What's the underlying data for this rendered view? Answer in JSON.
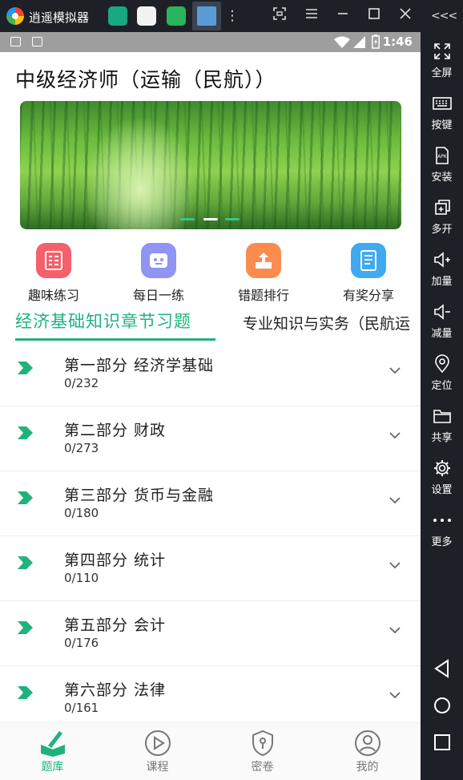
{
  "emulator": {
    "title": "逍遥模拟器",
    "side_buttons": [
      {
        "label": "全屏",
        "icon": "fullscreen-icon"
      },
      {
        "label": "按键",
        "icon": "keyboard-icon"
      },
      {
        "label": "安装",
        "icon": "apk-install-icon"
      },
      {
        "label": "多开",
        "icon": "multi-instance-icon"
      },
      {
        "label": "加量",
        "icon": "volume-up-icon"
      },
      {
        "label": "减量",
        "icon": "volume-down-icon"
      },
      {
        "label": "定位",
        "icon": "location-pin-icon"
      },
      {
        "label": "共享",
        "icon": "folder-icon"
      },
      {
        "label": "设置",
        "icon": "gear-icon"
      },
      {
        "label": "更多",
        "icon": "more-dots-icon"
      }
    ],
    "collapse_glyph": "<<<"
  },
  "status_bar": {
    "time": "1:46"
  },
  "app": {
    "title": "中级经济师（运输（民航））",
    "banner": {
      "slides": 3,
      "active_slide": 2
    },
    "quick_actions": [
      {
        "label": "趣味练习",
        "color": "#f4606b",
        "icon": "quiz-card-icon"
      },
      {
        "label": "每日一练",
        "color": "#8f94f5",
        "icon": "robot-face-icon"
      },
      {
        "label": "错题排行",
        "color": "#fb8c4f",
        "icon": "upload-tray-icon"
      },
      {
        "label": "有奖分享",
        "color": "#41a9f2",
        "icon": "notebook-icon"
      }
    ],
    "tabs": {
      "active": "经济基础知识章节习题",
      "second": "专业知识与实务（民航运"
    },
    "chapters": [
      {
        "title": "第一部分  经济学基础",
        "count": "0/232"
      },
      {
        "title": "第二部分  财政",
        "count": "0/273"
      },
      {
        "title": "第三部分  货币与金融",
        "count": "0/180"
      },
      {
        "title": "第四部分  统计",
        "count": "0/110"
      },
      {
        "title": "第五部分  会计",
        "count": "0/176"
      },
      {
        "title": "第六部分  法律",
        "count": "0/161"
      }
    ],
    "bottom_nav": [
      {
        "label": "题库",
        "icon": "book-pen-icon",
        "active": true
      },
      {
        "label": "课程",
        "icon": "play-circle-icon",
        "active": false
      },
      {
        "label": "密卷",
        "icon": "shield-lock-icon",
        "active": false
      },
      {
        "label": "我的",
        "icon": "user-circle-icon",
        "active": false
      }
    ],
    "accent_color": "#1fb37b"
  }
}
